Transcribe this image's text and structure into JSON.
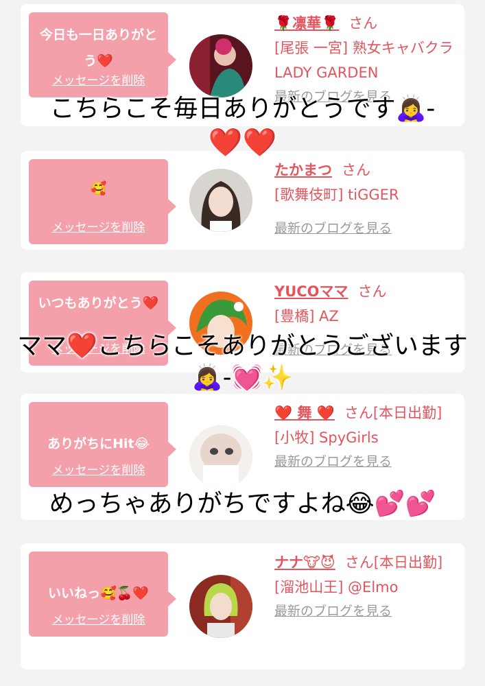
{
  "cards": [
    {
      "message": "今日も一日ありがとう❤️",
      "delete_label": "メッセージを削除",
      "name": "🌹凛華🌹",
      "san": "さん",
      "shop": "[尾張 一宮] 熟女キャバクラ LADY GARDEN",
      "blog_label": "最新のブログを見る"
    },
    {
      "message": "🥰",
      "delete_label": "メッセージを削除",
      "name": "たかまつ",
      "san": "さん",
      "shop": "[歌舞伎町] tiGGER",
      "blog_label": "最新のブログを見る"
    },
    {
      "message": "いつもありがとう❤️",
      "delete_label": "メッセージを削除",
      "name": "YUCOママ",
      "san": "さん",
      "shop": "[豊橋] AZ",
      "blog_label": "最新のブログを見る"
    },
    {
      "message": "ありがちにHit😂",
      "delete_label": "メッセージを削除",
      "name": "❤️ 舞 ❤️",
      "san": "さん[本日出勤]",
      "shop": "[小牧] SpyGirls",
      "blog_label": "最新のブログを見る"
    },
    {
      "message": "いいねっ🥰🍒❤️",
      "delete_label": "メッセージを削除",
      "name": "ナナ🐮😈",
      "san": "さん[本日出勤]",
      "shop": "[溜池山王] @Elmo",
      "blog_label": "最新のブログを見る"
    }
  ],
  "captions": {
    "caption1_line1": "こちらこそ毎日ありがとうです🙇‍♀️-",
    "caption1_line2": "❤️❤️",
    "caption2": "ママ❤️こちらこそありがとうございます🙇‍♀️-💓✨",
    "caption3": "めっちゃありがちですよね😂💕💕"
  },
  "colors": {
    "bubble": "#f4a0aa",
    "accent": "#e4545c",
    "background": "#f3f3f3"
  }
}
